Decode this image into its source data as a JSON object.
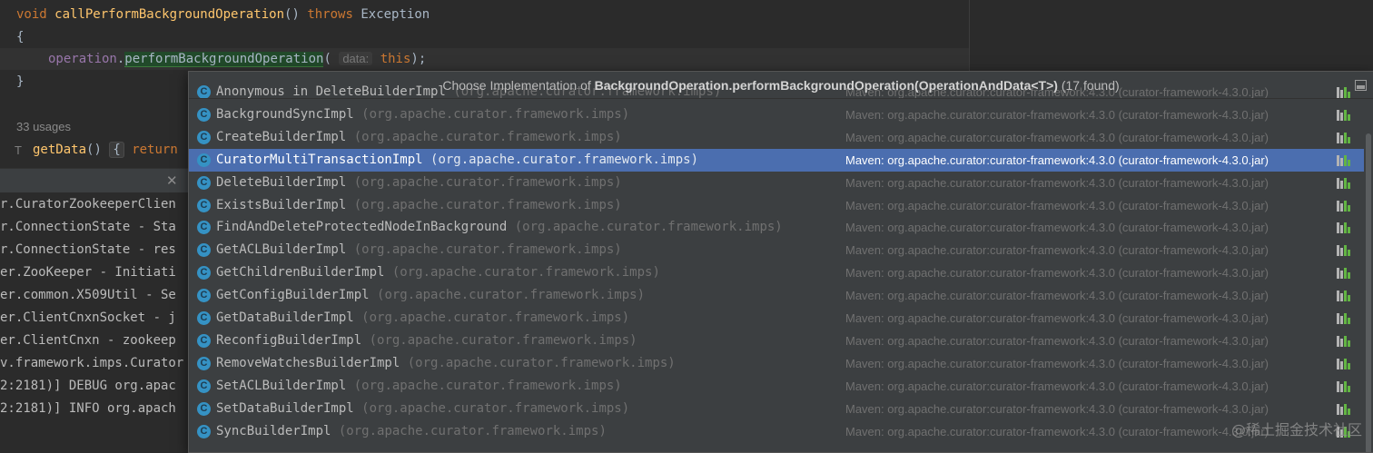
{
  "editor": {
    "line1": {
      "kw_void": "void",
      "method": "callPerformBackgroundOperation",
      "parens": "()",
      "kw_throws": "throws",
      "exception": "Exception"
    },
    "line2": "{",
    "line3": {
      "field": "operation",
      "dot": ".",
      "method": "performBackgroundOperation",
      "open": "(",
      "hint": "data:",
      "kw_this": "this",
      "close": ");"
    },
    "line4": "}",
    "usages": "33 usages",
    "impl_marker": "T",
    "getdata": {
      "method": "getData",
      "parens": "()",
      "folded": "{",
      "kw_return": "return"
    }
  },
  "console": {
    "close_icon": "close-icon",
    "lines": [
      "r.CuratorZookeeperClien",
      "r.ConnectionState - Sta",
      "r.ConnectionState - res",
      "er.ZooKeeper - Initiati",
      "er.common.X509Util - Se",
      "er.ClientCnxnSocket - j",
      "er.ClientCnxn - zookeep",
      "v.framework.imps.Curator",
      "2:2181)] DEBUG org.apac",
      "2:2181)] INFO org.apach"
    ]
  },
  "popup": {
    "title_prefix": "Choose Implementation of ",
    "title_bold": "BackgroundOperation.performBackgroundOperation(OperationAndData<T>)",
    "title_suffix": " (17 found)",
    "pin_icon": "pin-icon",
    "class_icon": "C",
    "items": [
      {
        "name": "Anonymous in DeleteBuilderImpl",
        "pkg": "(org.apache.curator.framework.imps)",
        "lib": "Maven: org.apache.curator:curator-framework:4.3.0 (curator-framework-4.3.0.jar)"
      },
      {
        "name": "BackgroundSyncImpl",
        "pkg": "(org.apache.curator.framework.imps)",
        "lib": "Maven: org.apache.curator:curator-framework:4.3.0 (curator-framework-4.3.0.jar)"
      },
      {
        "name": "CreateBuilderImpl",
        "pkg": "(org.apache.curator.framework.imps)",
        "lib": "Maven: org.apache.curator:curator-framework:4.3.0 (curator-framework-4.3.0.jar)"
      },
      {
        "name": "CuratorMultiTransactionImpl",
        "pkg": "(org.apache.curator.framework.imps)",
        "lib": "Maven: org.apache.curator:curator-framework:4.3.0 (curator-framework-4.3.0.jar)"
      },
      {
        "name": "DeleteBuilderImpl",
        "pkg": "(org.apache.curator.framework.imps)",
        "lib": "Maven: org.apache.curator:curator-framework:4.3.0 (curator-framework-4.3.0.jar)"
      },
      {
        "name": "ExistsBuilderImpl",
        "pkg": "(org.apache.curator.framework.imps)",
        "lib": "Maven: org.apache.curator:curator-framework:4.3.0 (curator-framework-4.3.0.jar)"
      },
      {
        "name": "FindAndDeleteProtectedNodeInBackground",
        "pkg": "(org.apache.curator.framework.imps)",
        "lib": "Maven: org.apache.curator:curator-framework:4.3.0 (curator-framework-4.3.0.jar)"
      },
      {
        "name": "GetACLBuilderImpl",
        "pkg": "(org.apache.curator.framework.imps)",
        "lib": "Maven: org.apache.curator:curator-framework:4.3.0 (curator-framework-4.3.0.jar)"
      },
      {
        "name": "GetChildrenBuilderImpl",
        "pkg": "(org.apache.curator.framework.imps)",
        "lib": "Maven: org.apache.curator:curator-framework:4.3.0 (curator-framework-4.3.0.jar)"
      },
      {
        "name": "GetConfigBuilderImpl",
        "pkg": "(org.apache.curator.framework.imps)",
        "lib": "Maven: org.apache.curator:curator-framework:4.3.0 (curator-framework-4.3.0.jar)"
      },
      {
        "name": "GetDataBuilderImpl",
        "pkg": "(org.apache.curator.framework.imps)",
        "lib": "Maven: org.apache.curator:curator-framework:4.3.0 (curator-framework-4.3.0.jar)"
      },
      {
        "name": "ReconfigBuilderImpl",
        "pkg": "(org.apache.curator.framework.imps)",
        "lib": "Maven: org.apache.curator:curator-framework:4.3.0 (curator-framework-4.3.0.jar)"
      },
      {
        "name": "RemoveWatchesBuilderImpl",
        "pkg": "(org.apache.curator.framework.imps)",
        "lib": "Maven: org.apache.curator:curator-framework:4.3.0 (curator-framework-4.3.0.jar)"
      },
      {
        "name": "SetACLBuilderImpl",
        "pkg": "(org.apache.curator.framework.imps)",
        "lib": "Maven: org.apache.curator:curator-framework:4.3.0 (curator-framework-4.3.0.jar)"
      },
      {
        "name": "SetDataBuilderImpl",
        "pkg": "(org.apache.curator.framework.imps)",
        "lib": "Maven: org.apache.curator:curator-framework:4.3.0 (curator-framework-4.3.0.jar)"
      },
      {
        "name": "SyncBuilderImpl",
        "pkg": "(org.apache.curator.framework.imps)",
        "lib": "Maven: org.apache.curator:curator-framework:4.3.0 (curator-framework-4.3.0.jar)"
      }
    ],
    "selected_index": 3
  },
  "watermark": "@稀土掘金技术社区"
}
